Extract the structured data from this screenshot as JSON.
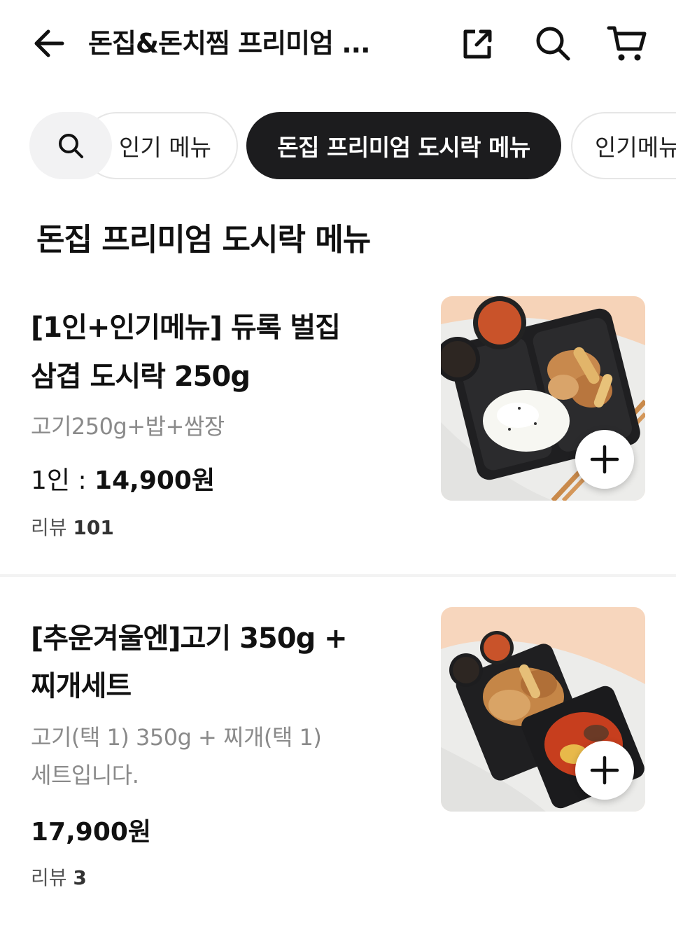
{
  "header": {
    "title": "돈집&돈치찜 프리미엄 ...",
    "icons": [
      "back-arrow-icon",
      "share-icon",
      "search-icon",
      "cart-icon"
    ]
  },
  "chips": {
    "search_icon": "search-icon",
    "items": [
      {
        "label": "인기 메뉴",
        "selected": false
      },
      {
        "label": "돈집 프리미엄 도시락 메뉴",
        "selected": true
      },
      {
        "label": "인기메뉴",
        "selected": false
      }
    ]
  },
  "section": {
    "title": "돈집 프리미엄 도시락 메뉴"
  },
  "menu_items": [
    {
      "name_line1": "[1인+인기메뉴] 듀록 벌집",
      "name_line2": "삼겹 도시락 250g",
      "desc_line1": "고기250g+밥+쌈장",
      "desc_line2": "",
      "price_prefix": "1인 : ",
      "price": "14,900원",
      "review_label": "리뷰 ",
      "review_count": "101"
    },
    {
      "name_line1": "[추운겨울엔]고기 350g +",
      "name_line2": "찌개세트",
      "desc_line1": "고기(택 1) 350g + 찌개(택 1)",
      "desc_line2": "세트입니다.",
      "price_prefix": "",
      "price": "17,900원",
      "review_label": "리뷰 ",
      "review_count": "3"
    }
  ],
  "colors": {
    "selected_chip_bg": "#1c1c1e",
    "selected_chip_text": "#ffffff",
    "description_text": "#8a8a8a",
    "photo_background": "#f7d9c4"
  }
}
